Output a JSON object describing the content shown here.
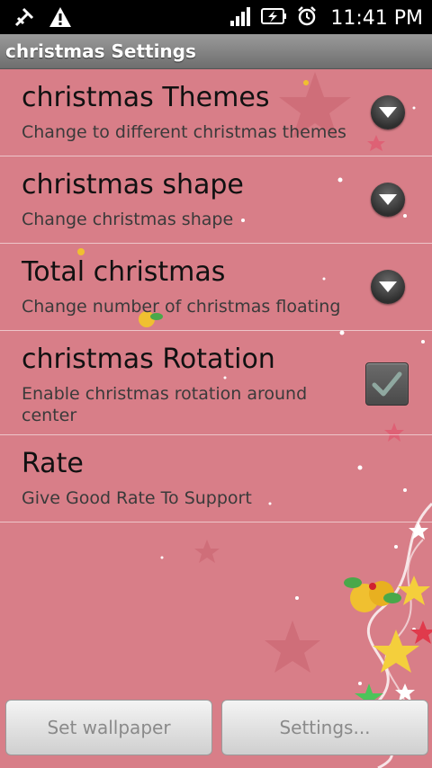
{
  "status_bar": {
    "time": "11:41 PM",
    "icons": [
      "usb-debug-icon",
      "warning-icon",
      "signal-icon",
      "battery-charging-icon",
      "alarm-icon"
    ]
  },
  "title_bar": {
    "title": "christmas Settings"
  },
  "preferences": [
    {
      "title": "christmas Themes",
      "summary": "Change to different christmas themes",
      "widget": "dropdown"
    },
    {
      "title": "christmas shape",
      "summary": "Change christmas shape",
      "widget": "dropdown"
    },
    {
      "title": "Total christmas",
      "summary": "Change number of christmas floating",
      "widget": "dropdown"
    },
    {
      "title": "christmas Rotation",
      "summary": "Enable christmas rotation around center",
      "widget": "checkbox",
      "checked": true
    },
    {
      "title": "Rate",
      "summary": "Give Good Rate To Support",
      "widget": "none"
    }
  ],
  "buttons": {
    "set_wallpaper": "Set wallpaper",
    "settings": "Settings..."
  },
  "colors": {
    "background": "#d87e88",
    "title_bar": "#808080",
    "status_bar": "#000000"
  }
}
